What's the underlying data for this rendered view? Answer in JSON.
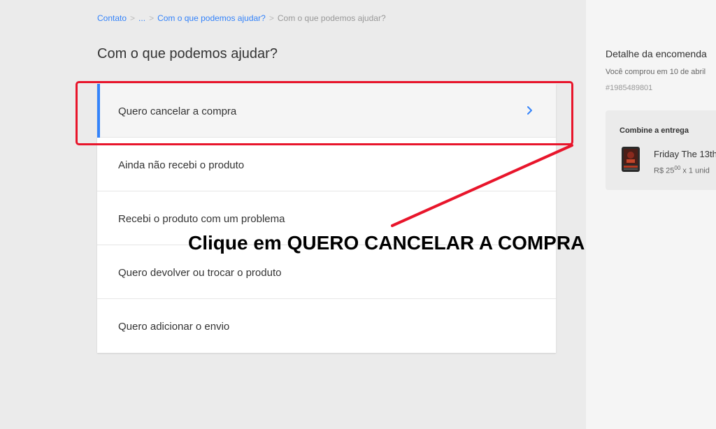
{
  "breadcrumb": {
    "items": [
      "Contato",
      "...",
      "Com o que podemos ajudar?"
    ],
    "current": "Com o que podemos ajudar?",
    "separator": ">"
  },
  "page_title": "Com o que podemos ajudar?",
  "options": [
    {
      "label": "Quero cancelar a compra",
      "selected": true
    },
    {
      "label": "Ainda não recebi o produto",
      "selected": false
    },
    {
      "label": "Recebi o produto com um problema",
      "selected": false
    },
    {
      "label": "Quero devolver ou trocar o produto",
      "selected": false
    },
    {
      "label": "Quero adicionar o envio",
      "selected": false
    }
  ],
  "annotation": {
    "text": "Clique em QUERO CANCELAR A COMPRA",
    "color": "#e8152b"
  },
  "order": {
    "title": "Detalhe da encomenda",
    "date": "Você comprou em 10 de abril",
    "number": "#1985489801"
  },
  "delivery": {
    "title": "Combine a entrega",
    "product_name": "Friday The 13th",
    "price_currency": "R$",
    "price_main": "25",
    "price_cents": "00",
    "quantity": "x 1 unid"
  },
  "colors": {
    "accent": "#3483fa",
    "highlight": "#e8152b"
  },
  "icons": {
    "option_chevron": "chevron-right-icon"
  }
}
